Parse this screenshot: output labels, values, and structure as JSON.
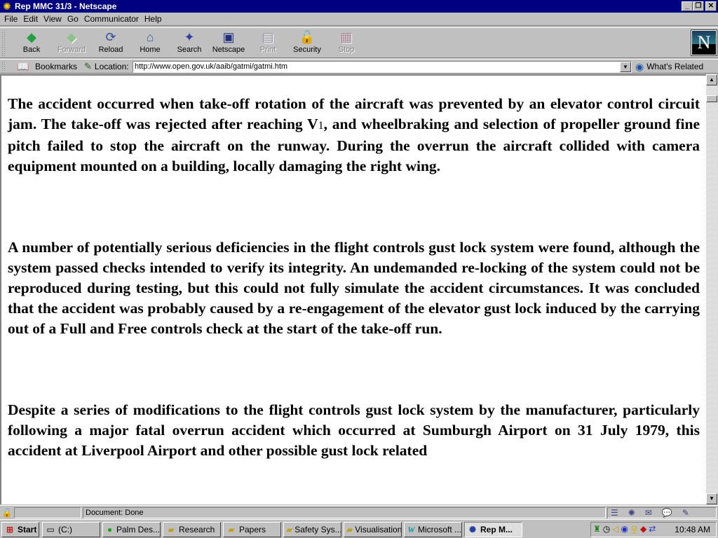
{
  "window": {
    "title": "Rep MMC 31/3 - Netscape",
    "controls": [
      "minimize",
      "restore",
      "close"
    ]
  },
  "menu": {
    "items": [
      {
        "label": "File",
        "accel": "F"
      },
      {
        "label": "Edit",
        "accel": "E"
      },
      {
        "label": "View",
        "accel": "V"
      },
      {
        "label": "Go",
        "accel": "G"
      },
      {
        "label": "Communicator",
        "accel": "C"
      },
      {
        "label": "Help",
        "accel": "H"
      }
    ]
  },
  "toolbar": {
    "buttons": [
      {
        "label": "Back",
        "icon": "back-arrow-icon",
        "glyph": "◆",
        "color": "#20a040",
        "enabled": true
      },
      {
        "label": "Forward",
        "icon": "forward-arrow-icon",
        "glyph": "◆",
        "color": "#90c090",
        "enabled": false
      },
      {
        "label": "Reload",
        "icon": "reload-icon",
        "glyph": "⟳",
        "color": "#3050a0",
        "enabled": true
      },
      {
        "label": "Home",
        "icon": "home-icon",
        "glyph": "⌂",
        "color": "#4060a0",
        "enabled": true
      },
      {
        "label": "Search",
        "icon": "search-icon",
        "glyph": "✦",
        "color": "#3040a0",
        "enabled": true
      },
      {
        "label": "Netscape",
        "icon": "my-netscape-icon",
        "glyph": "▣",
        "color": "#203080",
        "enabled": true
      },
      {
        "label": "Print",
        "icon": "print-icon",
        "glyph": "▤",
        "color": "#9090a0",
        "enabled": false
      },
      {
        "label": "Security",
        "icon": "security-lock-icon",
        "glyph": "🔓",
        "color": "#a02020",
        "enabled": true
      },
      {
        "label": "Stop",
        "icon": "stop-icon",
        "glyph": "▦",
        "color": "#a08090",
        "enabled": false
      }
    ],
    "logo": "N"
  },
  "location_bar": {
    "bookmarks_label": "Bookmarks",
    "location_label": "Location:",
    "url": "http://www.open.gov.uk/aaib/gatmi/gatmi.htm",
    "whats_related_label": "What's Related"
  },
  "content": {
    "paragraphs": [
      {
        "before_sub": "The accident occurred when take-off rotation of the aircraft was prevented by an elevator control circuit jam. The take-off was rejected after reaching V",
        "sub": "1",
        "after_sub": ", and wheelbraking and selection of propeller ground fine pitch failed to stop the aircraft on the runway. During the overrun the aircraft collided with camera equipment mounted on a building, locally damaging the right wing."
      },
      {
        "text": "A number of potentially serious deficiencies in the flight controls gust lock system were found, although the system passed checks intended to verify its integrity. An undemanded re-locking of the system could not be reproduced during testing, but this could not fully simulate the accident circumstances. It was concluded that the accident was probably caused by a re-engagement of the elevator gust lock induced by the carrying out of a Full and Free controls check at the start of the take-off run."
      },
      {
        "text": "Despite a series of modifications to the flight controls gust lock system by the manufacturer, particularly following a major fatal overrun accident which occurred at Sumburgh Airport on 31 July 1979, this accident at Liverpool Airport and other possible gust lock related"
      }
    ]
  },
  "status_bar": {
    "text": "Document: Done"
  },
  "taskbar": {
    "start_label": "Start",
    "buttons": [
      {
        "label": "(C:)",
        "icon": "drive-icon",
        "glyph": "▭",
        "active": false
      },
      {
        "label": "Palm Des...",
        "icon": "palm-desktop-icon",
        "glyph": "●",
        "active": false
      },
      {
        "label": "Research",
        "icon": "folder-icon",
        "glyph": "🗀",
        "active": false
      },
      {
        "label": "Papers",
        "icon": "folder-icon",
        "glyph": "🗀",
        "active": false
      },
      {
        "label": "Safety Sys...",
        "icon": "folder-icon",
        "glyph": "🗀",
        "active": false
      },
      {
        "label": "Visualisation",
        "icon": "folder-icon",
        "glyph": "🗀",
        "active": false
      },
      {
        "label": "Microsoft ...",
        "icon": "word-icon",
        "glyph": "W",
        "active": false
      },
      {
        "label": "Rep M...",
        "icon": "netscape-icon",
        "glyph": "✺",
        "active": true
      }
    ],
    "clock": "10:48 AM"
  }
}
